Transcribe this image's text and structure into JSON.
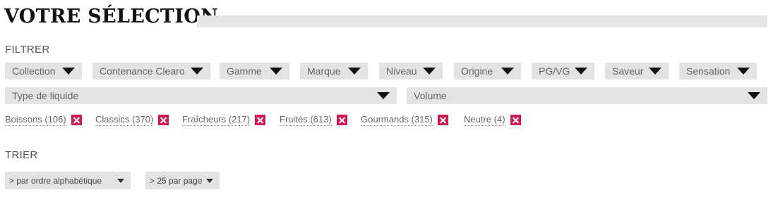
{
  "header": {
    "title": "VOTRE SÉLECTION"
  },
  "filter": {
    "label": "FILTRER",
    "dropdowns": [
      "Collection",
      "Contenance Clearo",
      "Gamme",
      "Marque",
      "Niveau",
      "Origine",
      "PG/VG",
      "Saveur",
      "Sensation",
      "Type de liquide",
      "Volume"
    ]
  },
  "active_filters": [
    "Boissons (106)",
    "Classics (370)",
    "Fraîcheurs (217)",
    "Fruités (613)",
    "Gourmands (315)",
    "Neutre (4)"
  ],
  "sort": {
    "label": "TRIER",
    "order": "> par ordre alphabétique",
    "per_page": "> 25 par page"
  },
  "colors": {
    "remove_accent": "#d0174f",
    "dropdown_bg": "#e3e3e3"
  }
}
